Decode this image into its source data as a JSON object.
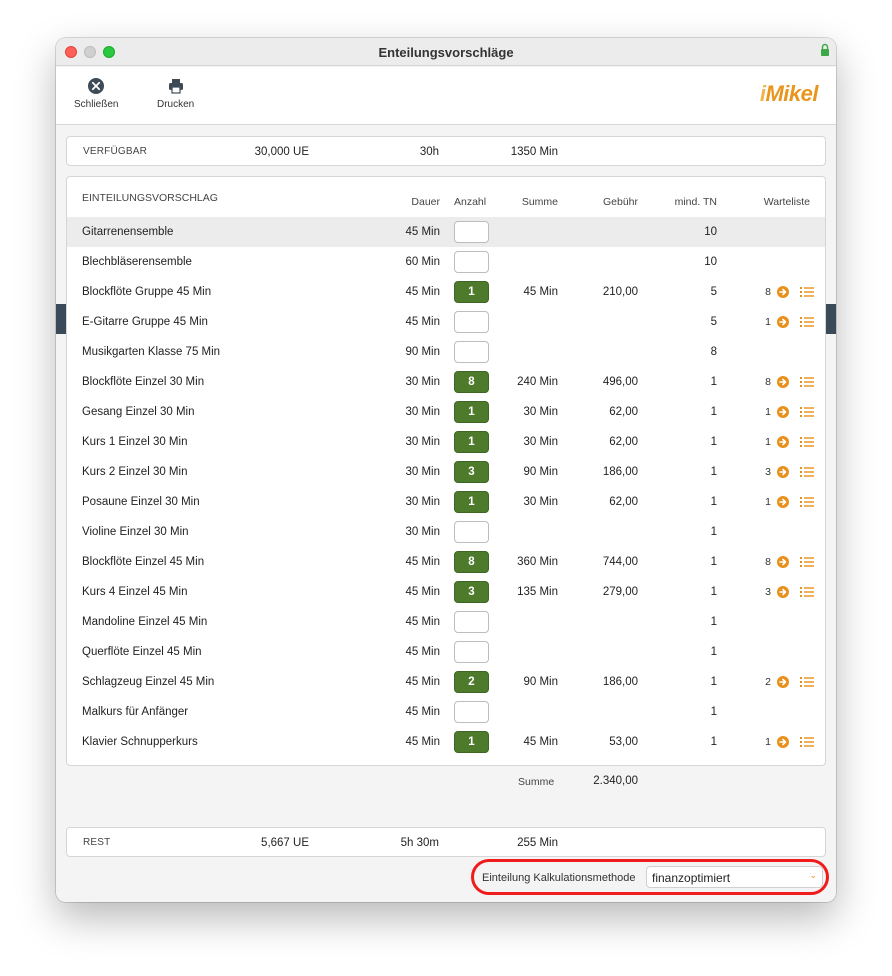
{
  "window": {
    "title": "Enteilungsvorschläge"
  },
  "toolbar": {
    "close_label": "Schließen",
    "print_label": "Drucken",
    "logo_i": "i",
    "logo_text": "Mikel"
  },
  "verfuegbar": {
    "label": "VERFÜGBAR",
    "ue": "30,000 UE",
    "hours": "30h",
    "minutes": "1350 Min"
  },
  "table": {
    "title": "EINTEILUNGSVORSCHLAG",
    "headers": {
      "dauer": "Dauer",
      "anzahl": "Anzahl",
      "summe": "Summe",
      "gebuehr": "Gebühr",
      "mind_tn": "mind. TN",
      "warteliste": "Warteliste"
    },
    "rows": [
      {
        "name": "Gitarrenensemble",
        "dauer": "45 Min",
        "anzahl": "",
        "summe": "",
        "gebuehr": "",
        "mind_tn": "10",
        "warteliste": ""
      },
      {
        "name": "Blechbläserensemble",
        "dauer": "60 Min",
        "anzahl": "",
        "summe": "",
        "gebuehr": "",
        "mind_tn": "10",
        "warteliste": ""
      },
      {
        "name": "Blockflöte Gruppe 45 Min",
        "dauer": "45 Min",
        "anzahl": "1",
        "summe": "45 Min",
        "gebuehr": "210,00",
        "mind_tn": "5",
        "warteliste": "8"
      },
      {
        "name": "E-Gitarre Gruppe 45 Min",
        "dauer": "45 Min",
        "anzahl": "",
        "summe": "",
        "gebuehr": "",
        "mind_tn": "5",
        "warteliste": "1"
      },
      {
        "name": "Musikgarten Klasse 75 Min",
        "dauer": "90 Min",
        "anzahl": "",
        "summe": "",
        "gebuehr": "",
        "mind_tn": "8",
        "warteliste": ""
      },
      {
        "name": "Blockflöte Einzel 30 Min",
        "dauer": "30 Min",
        "anzahl": "8",
        "summe": "240 Min",
        "gebuehr": "496,00",
        "mind_tn": "1",
        "warteliste": "8"
      },
      {
        "name": "Gesang Einzel 30 Min",
        "dauer": "30 Min",
        "anzahl": "1",
        "summe": "30 Min",
        "gebuehr": "62,00",
        "mind_tn": "1",
        "warteliste": "1"
      },
      {
        "name": "Kurs 1 Einzel 30 Min",
        "dauer": "30 Min",
        "anzahl": "1",
        "summe": "30 Min",
        "gebuehr": "62,00",
        "mind_tn": "1",
        "warteliste": "1"
      },
      {
        "name": "Kurs 2 Einzel 30 Min",
        "dauer": "30 Min",
        "anzahl": "3",
        "summe": "90 Min",
        "gebuehr": "186,00",
        "mind_tn": "1",
        "warteliste": "3"
      },
      {
        "name": "Posaune Einzel 30 Min",
        "dauer": "30 Min",
        "anzahl": "1",
        "summe": "30 Min",
        "gebuehr": "62,00",
        "mind_tn": "1",
        "warteliste": "1"
      },
      {
        "name": "Violine Einzel 30 Min",
        "dauer": "30 Min",
        "anzahl": "",
        "summe": "",
        "gebuehr": "",
        "mind_tn": "1",
        "warteliste": ""
      },
      {
        "name": "Blockflöte Einzel 45 Min",
        "dauer": "45 Min",
        "anzahl": "8",
        "summe": "360 Min",
        "gebuehr": "744,00",
        "mind_tn": "1",
        "warteliste": "8"
      },
      {
        "name": "Kurs 4 Einzel 45 Min",
        "dauer": "45 Min",
        "anzahl": "3",
        "summe": "135 Min",
        "gebuehr": "279,00",
        "mind_tn": "1",
        "warteliste": "3"
      },
      {
        "name": "Mandoline Einzel 45 Min",
        "dauer": "45 Min",
        "anzahl": "",
        "summe": "",
        "gebuehr": "",
        "mind_tn": "1",
        "warteliste": ""
      },
      {
        "name": "Querflöte Einzel 45 Min",
        "dauer": "45 Min",
        "anzahl": "",
        "summe": "",
        "gebuehr": "",
        "mind_tn": "1",
        "warteliste": ""
      },
      {
        "name": "Schlagzeug Einzel 45 Min",
        "dauer": "45 Min",
        "anzahl": "2",
        "summe": "90 Min",
        "gebuehr": "186,00",
        "mind_tn": "1",
        "warteliste": "2"
      },
      {
        "name": "Malkurs für Anfänger",
        "dauer": "45 Min",
        "anzahl": "",
        "summe": "",
        "gebuehr": "",
        "mind_tn": "1",
        "warteliste": ""
      },
      {
        "name": "Klavier Schnupperkurs",
        "dauer": "45 Min",
        "anzahl": "1",
        "summe": "45 Min",
        "gebuehr": "53,00",
        "mind_tn": "1",
        "warteliste": "1"
      }
    ],
    "summe_label": "Summe",
    "summe_value": "2.340,00"
  },
  "rest": {
    "label": "REST",
    "ue": "5,667 UE",
    "hours": "5h 30m",
    "minutes": "255 Min"
  },
  "calculation": {
    "label": "Einteilung Kalkulationsmethode",
    "selected": "finanzoptimiert"
  },
  "colors": {
    "accent_orange": "#e8901a",
    "filled_green": "#4e7a2c",
    "highlight_red": "#f01c1c"
  }
}
